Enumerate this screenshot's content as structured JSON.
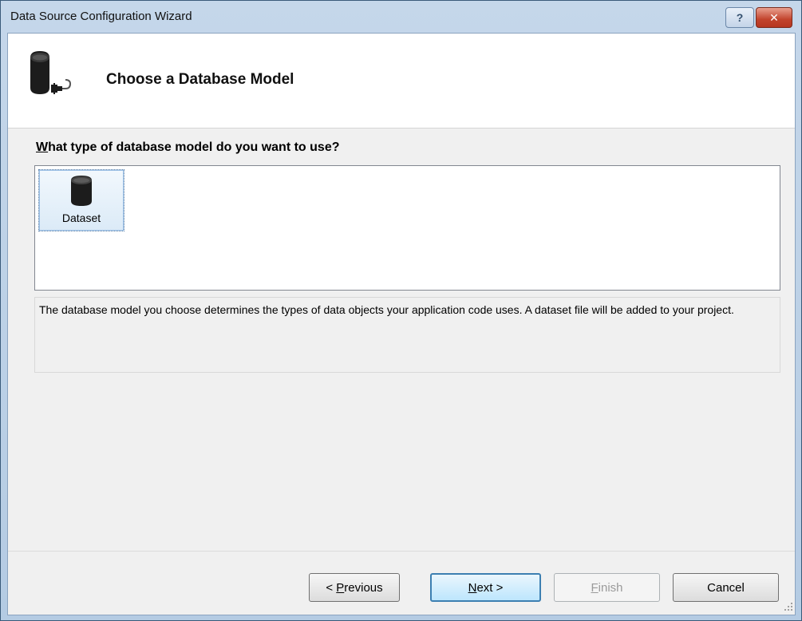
{
  "window": {
    "title": "Data Source Configuration Wizard",
    "help_glyph": "?",
    "close_glyph": "✕"
  },
  "header": {
    "title": "Choose a Database Model",
    "icon": "database-connection-icon"
  },
  "question": {
    "accel": "W",
    "rest": "hat type of database model do you want to use?"
  },
  "model_list": {
    "items": [
      {
        "label": "Dataset",
        "icon": "database-icon",
        "selected": true
      }
    ]
  },
  "description": "The database model you choose determines the types of data objects your application code uses. A dataset file will be added to your project.",
  "buttons": {
    "previous": {
      "prefix": "< ",
      "accel": "P",
      "rest": "revious",
      "enabled": true
    },
    "next": {
      "accel": "N",
      "rest": "ext >",
      "enabled": true,
      "default": true
    },
    "finish": {
      "accel": "F",
      "rest": "inish",
      "enabled": false
    },
    "cancel": {
      "label": "Cancel",
      "enabled": true
    }
  }
}
